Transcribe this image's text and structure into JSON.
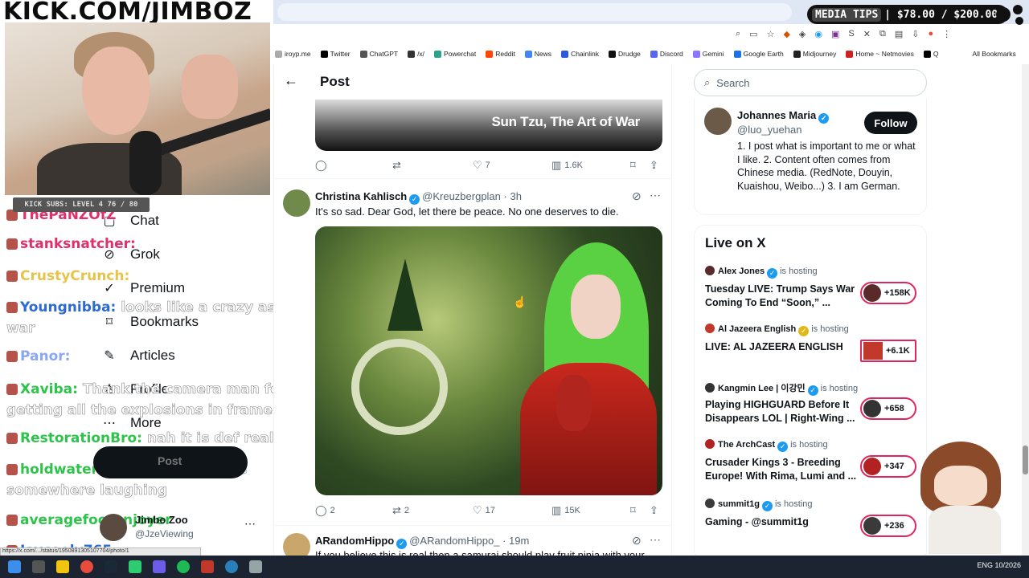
{
  "stream": {
    "banner": "KICK.COM/JIMBOZ",
    "media_tips_label": "MEDIA TIPS",
    "media_tips_value": "| $78.00 / $200.00",
    "subs": "KICK SUBS: LEVEL 4 76 / 80"
  },
  "browser": {
    "bookmarks": [
      {
        "label": "iroyp.me",
        "color": "#aaaaaa"
      },
      {
        "label": "Twitter",
        "color": "#000000"
      },
      {
        "label": "ChatGPT",
        "color": "#555555"
      },
      {
        "label": "/x/",
        "color": "#333333"
      },
      {
        "label": "Powerchat",
        "color": "#2aa38a"
      },
      {
        "label": "Reddit",
        "color": "#ff4500"
      },
      {
        "label": "News",
        "color": "#4285f4"
      },
      {
        "label": "Chainlink",
        "color": "#2a5ada"
      },
      {
        "label": "Drudge",
        "color": "#111111"
      },
      {
        "label": "Discord",
        "color": "#5865f2"
      },
      {
        "label": "Gemini",
        "color": "#8e75ff"
      },
      {
        "label": "Google Earth",
        "color": "#1a73e8"
      },
      {
        "label": "Midjourney",
        "color": "#222222"
      },
      {
        "label": "Home ~ Netmovies",
        "color": "#cc2222"
      },
      {
        "label": "Q",
        "color": "#000000"
      }
    ],
    "all_bookmarks": "All Bookmarks",
    "status_url": "https://x.com/.../status/1950891305107704/photo/1"
  },
  "nav": {
    "items": [
      {
        "label": "Chat",
        "icon": "chat-icon",
        "glyph": "▢"
      },
      {
        "label": "Grok",
        "icon": "grok-icon",
        "glyph": "⊘"
      },
      {
        "label": "Premium",
        "icon": "premium-icon",
        "glyph": "✓"
      },
      {
        "label": "Bookmarks",
        "icon": "bookmark-icon",
        "glyph": "⌑"
      },
      {
        "label": "Articles",
        "icon": "articles-icon",
        "glyph": "✎"
      },
      {
        "label": "Profile",
        "icon": "profile-icon",
        "glyph": "♙"
      },
      {
        "label": "More",
        "icon": "more-icon",
        "glyph": "⋯"
      }
    ],
    "post_button": "Post",
    "account_name": "Jimbo Zoo",
    "account_handle": "@JzeViewing"
  },
  "chat": {
    "lines": [
      {
        "user": "ThePaNZOfZ",
        "msg": "",
        "color": "#e0306a"
      },
      {
        "user": "stanksnatcher:",
        "msg": "",
        "color": "#e0306a"
      },
      {
        "user": "CrustyCrunch:",
        "msg": "",
        "color": "#e6c44a"
      },
      {
        "user": "Youngnibba:",
        "msg": "looks like a crazy ass war",
        "color": "#2d6ad6"
      },
      {
        "user": "Panor:",
        "msg": "",
        "color": "#8aa8f0"
      },
      {
        "user": "Xaviba:",
        "msg": "Thank the camera man for getting all the explosions in frame",
        "color": "#2ec34a"
      },
      {
        "user": "RestorationBro:",
        "msg": "nah it is def real",
        "color": "#2ec34a"
      },
      {
        "user": "holdwater:",
        "msg": "Stanley Kubrick is somewhere laughing",
        "color": "#2ec34a"
      },
      {
        "user": "averagefootenjoyer",
        "msg": "",
        "color": "#2ec34a"
      },
      {
        "user": "Jaycooly765",
        "msg": "",
        "color": "#2d6ad6"
      }
    ]
  },
  "post": {
    "header_title": "Post",
    "top_image_caption": "Sun Tzu, The Art of War",
    "top_actions": {
      "replies": "",
      "reposts": "",
      "likes": "7",
      "views": "1.6K"
    },
    "tweet1": {
      "name": "Christina Kahlisch",
      "handle": "@Kreuzbergplan",
      "time": "· 3h",
      "text": "It's so sad. Dear God, let there be peace. No one deserves to die.",
      "replies": "2",
      "reposts": "2",
      "likes": "17",
      "views": "15K"
    },
    "tweet2": {
      "name": "ARandomHippo",
      "handle": "@ARandomHippo_",
      "time": "· 19m",
      "text": "If you believe this is real then a samurai should play fruit ninja with your"
    }
  },
  "sidebar": {
    "search_placeholder": "Search",
    "profile": {
      "name": "Johannes Maria",
      "handle": "@luo_yuehan",
      "follow": "Follow",
      "bio": "1. I post what is important to me or what I like. 2. Content often comes from Chinese media. (RedNote, Douyin, Kuaishou, Weibo...) 3. I am German."
    },
    "live_title": "Live on X",
    "live_items": [
      {
        "host": "Alex Jones",
        "status": "is hosting",
        "title": "Tuesday LIVE: Trump Says War Coming To End “Soon,” ...",
        "count": "+158K",
        "badge": "blue",
        "avatar_color": "#5a2a2a"
      },
      {
        "host": "Al Jazeera English",
        "status": "is hosting",
        "title": "LIVE: AL JAZEERA ENGLISH",
        "count": "+6.1K",
        "badge": "gold",
        "avatar_color": "#c0392b"
      },
      {
        "host": "Kangmin Lee | 이강민",
        "status": "is hosting",
        "title": "Playing HIGHGUARD Before It Disappears LOL | Right-Wing ...",
        "count": "+658",
        "badge": "blue",
        "avatar_color": "#333333"
      },
      {
        "host": "The ArchCast",
        "status": "is hosting",
        "title": "Crusader Kings 3 - Breeding Europe! With Rima, Lumi and ...",
        "count": "+347",
        "badge": "blue",
        "avatar_color": "#b22222"
      },
      {
        "host": "summit1g",
        "status": "is hosting",
        "title": "Gaming - @summit1g",
        "count": "+236",
        "badge": "blue",
        "avatar_color": "#3a3a3a"
      }
    ]
  },
  "taskbar": {
    "tray_text": "ENG  10/2026"
  }
}
